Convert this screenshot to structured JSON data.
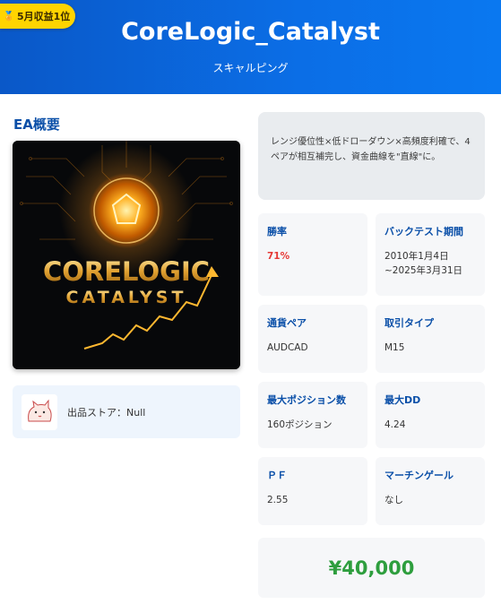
{
  "header": {
    "badge": "5月収益1位",
    "title": "CoreLogic_Catalyst",
    "subtitle": "スキャルピング"
  },
  "overview": {
    "title": "EA概要",
    "image_alt_text": "CORELOGIC CATALYST",
    "image_line1": "CORELOGIC",
    "image_line2": "CATALYST"
  },
  "store": {
    "label": "出品ストア：Null"
  },
  "description": "レンジ優位性×低ドローダウン×高頻度利確で、4ペアが相互補完し、資金曲線を\"直線\"に。",
  "stats": [
    {
      "label": "勝率",
      "value": "71%"
    },
    {
      "label": "バックテスト期間",
      "value": "2010年1月4日~2025年3月31日"
    },
    {
      "label": "通貨ペア",
      "value": "AUDCAD"
    },
    {
      "label": "取引タイプ",
      "value": "M15"
    },
    {
      "label": "最大ポジション数",
      "value": "160ポジション"
    },
    {
      "label": "最大DD",
      "value": "4.24"
    },
    {
      "label": "ＰＦ",
      "value": "2.55"
    },
    {
      "label": "マーチンゲール",
      "value": "なし"
    }
  ],
  "price": "¥40,000",
  "colors": {
    "header_blue": "#0b6ee6",
    "badge_yellow": "#ffd400",
    "label_blue": "#0a4fa8",
    "win_rate_red": "#e53935",
    "price_green": "#2e9e3e"
  },
  "icons": {
    "badge_icon": "medal-icon",
    "store_avatar": "cat-avatar-icon"
  }
}
